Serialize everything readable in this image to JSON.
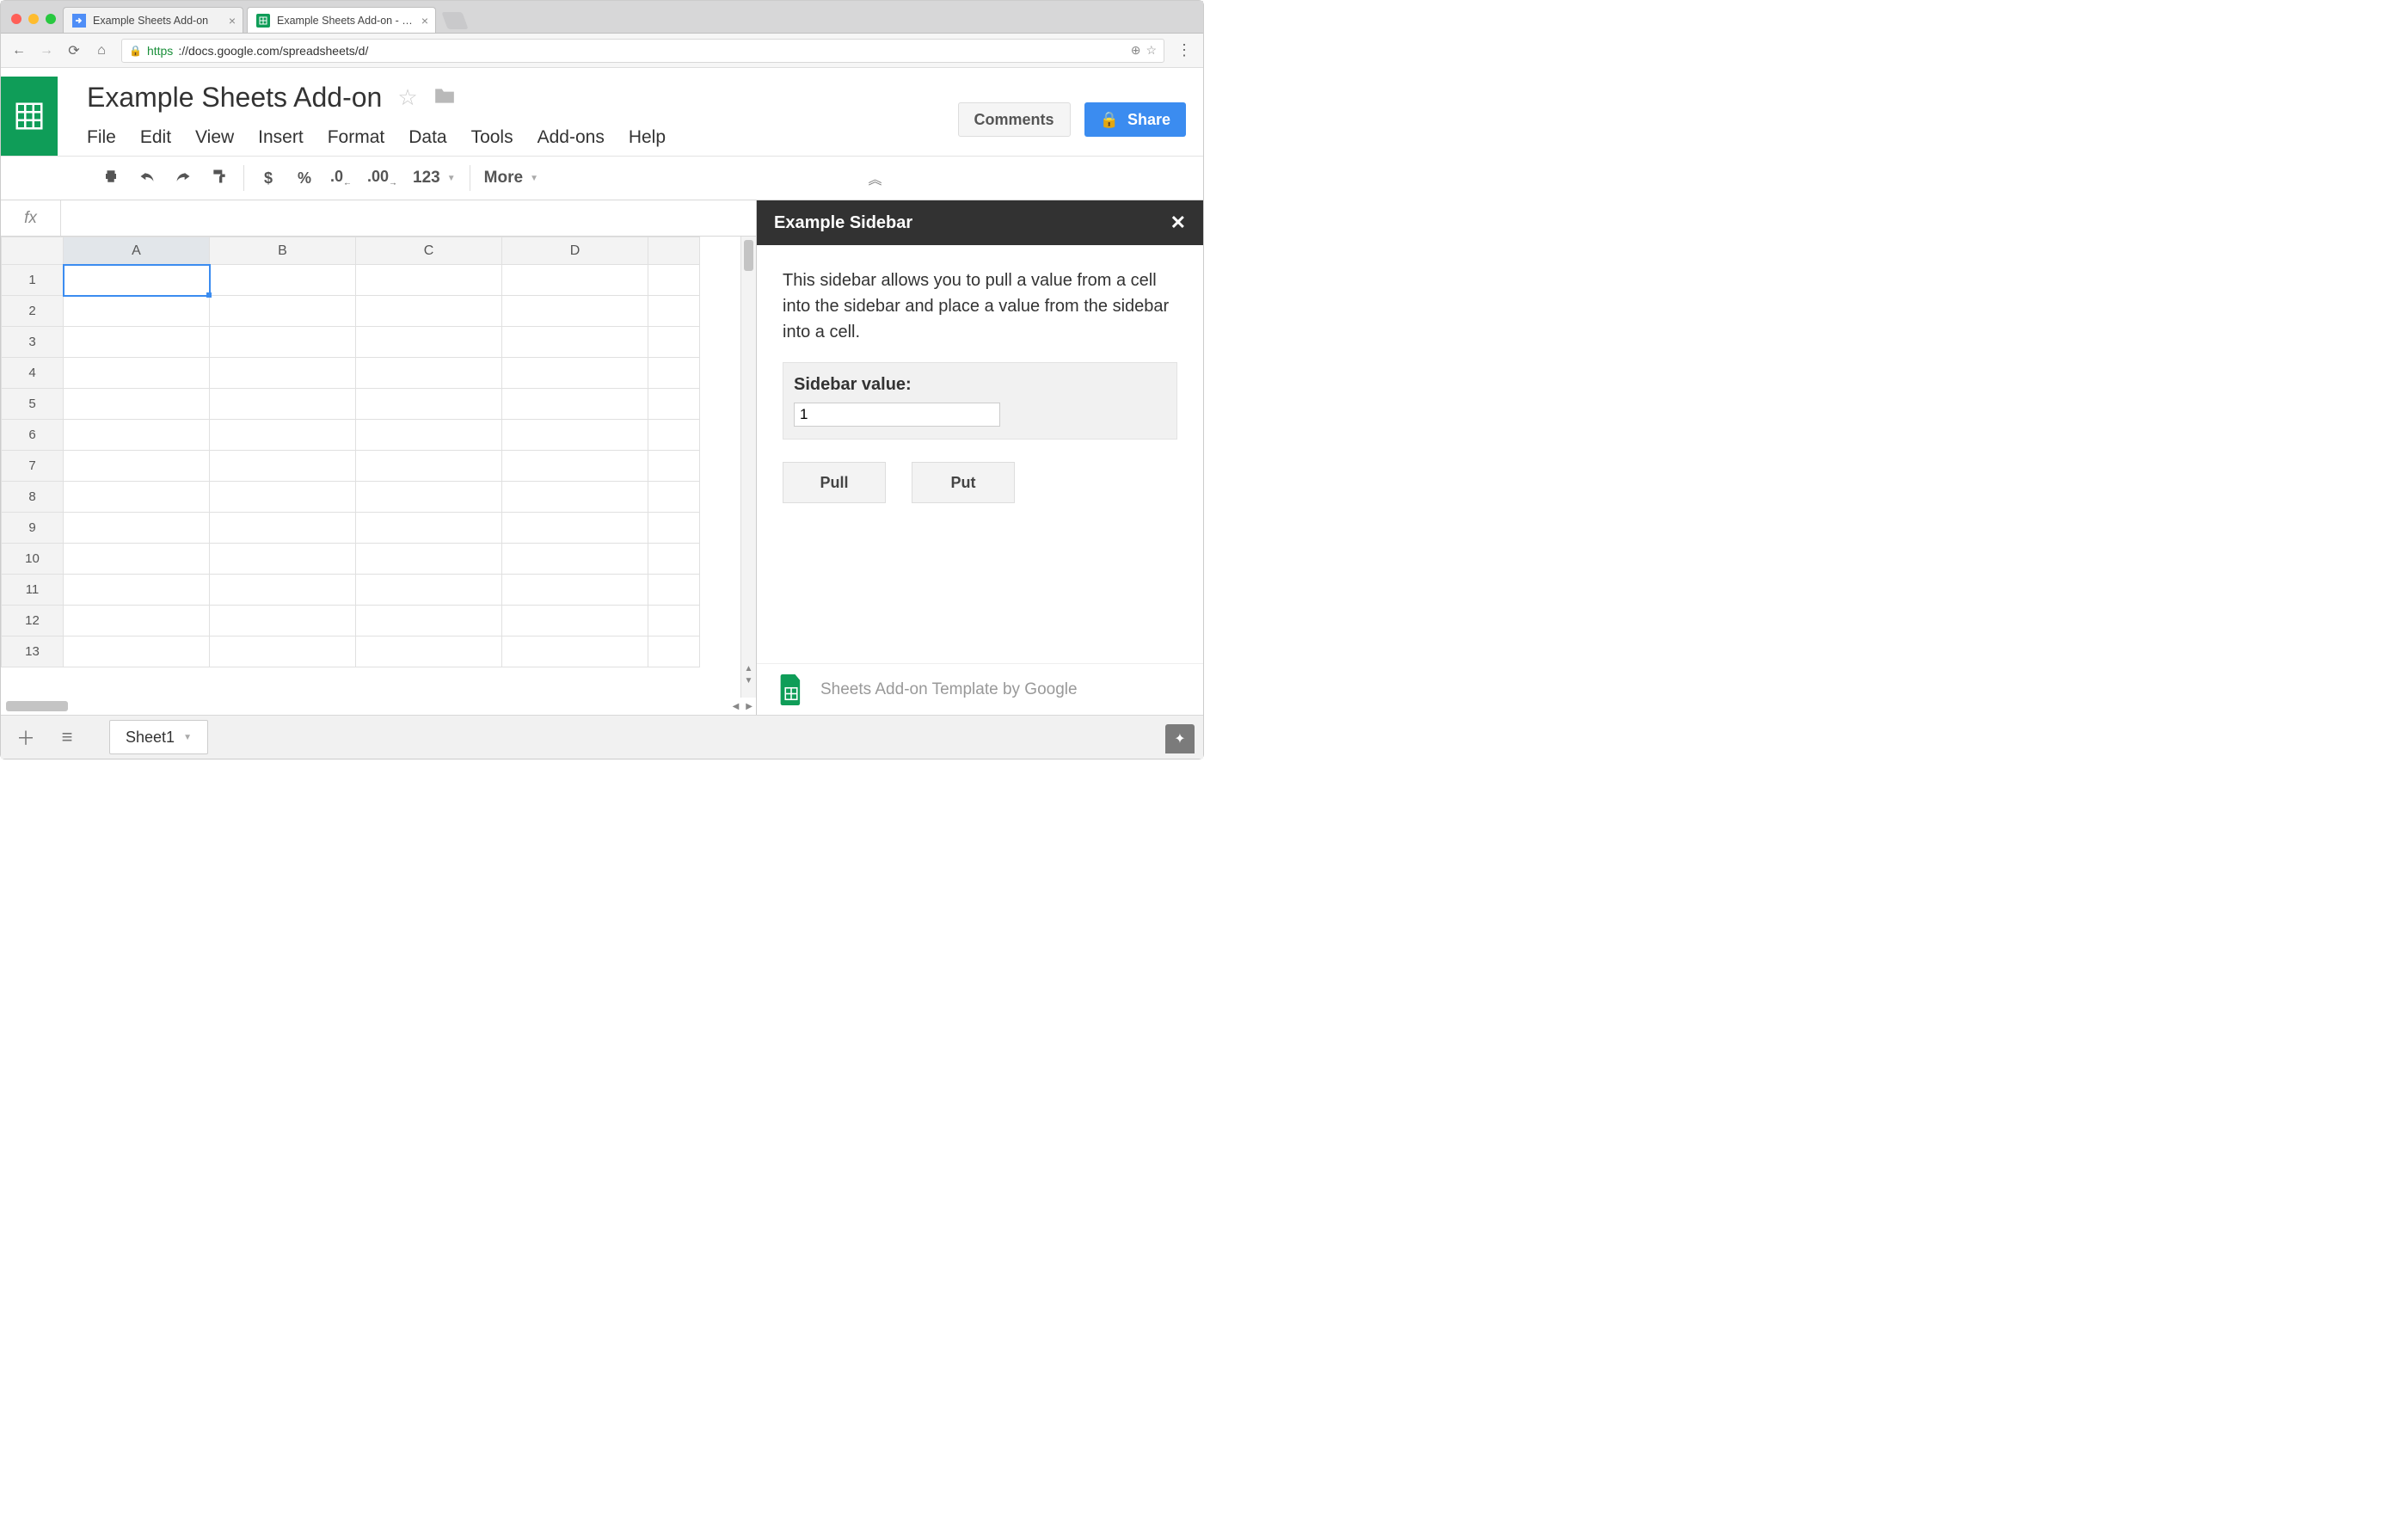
{
  "browser": {
    "tabs": [
      {
        "label": "Example Sheets Add-on",
        "active": false
      },
      {
        "label": "Example Sheets Add-on - Goo",
        "active": true
      }
    ],
    "url_https": "https",
    "url_rest": "://docs.google.com/spreadsheets/d/"
  },
  "doc": {
    "title": "Example Sheets Add-on",
    "menus": [
      "File",
      "Edit",
      "View",
      "Insert",
      "Format",
      "Data",
      "Tools",
      "Add-ons",
      "Help"
    ],
    "comments_btn": "Comments",
    "share_btn": "Share"
  },
  "toolbar": {
    "currency": "$",
    "percent": "%",
    "dec_less": ".0",
    "dec_more": ".00",
    "numfmt": "123",
    "more": "More"
  },
  "grid": {
    "columns": [
      "A",
      "B",
      "C",
      "D",
      ""
    ],
    "rows": [
      "1",
      "2",
      "3",
      "4",
      "5",
      "6",
      "7",
      "8",
      "9",
      "10",
      "11",
      "12",
      "13"
    ],
    "selected_cell": "A1"
  },
  "sidebar": {
    "title": "Example Sidebar",
    "description": "This sidebar allows you to pull a value from a cell into the sidebar and place a value from the sidebar into a cell.",
    "value_label": "Sidebar value:",
    "value": "1",
    "pull_btn": "Pull",
    "put_btn": "Put",
    "footer": "Sheets Add-on Template by Google"
  },
  "footer": {
    "sheet_tab": "Sheet1"
  }
}
